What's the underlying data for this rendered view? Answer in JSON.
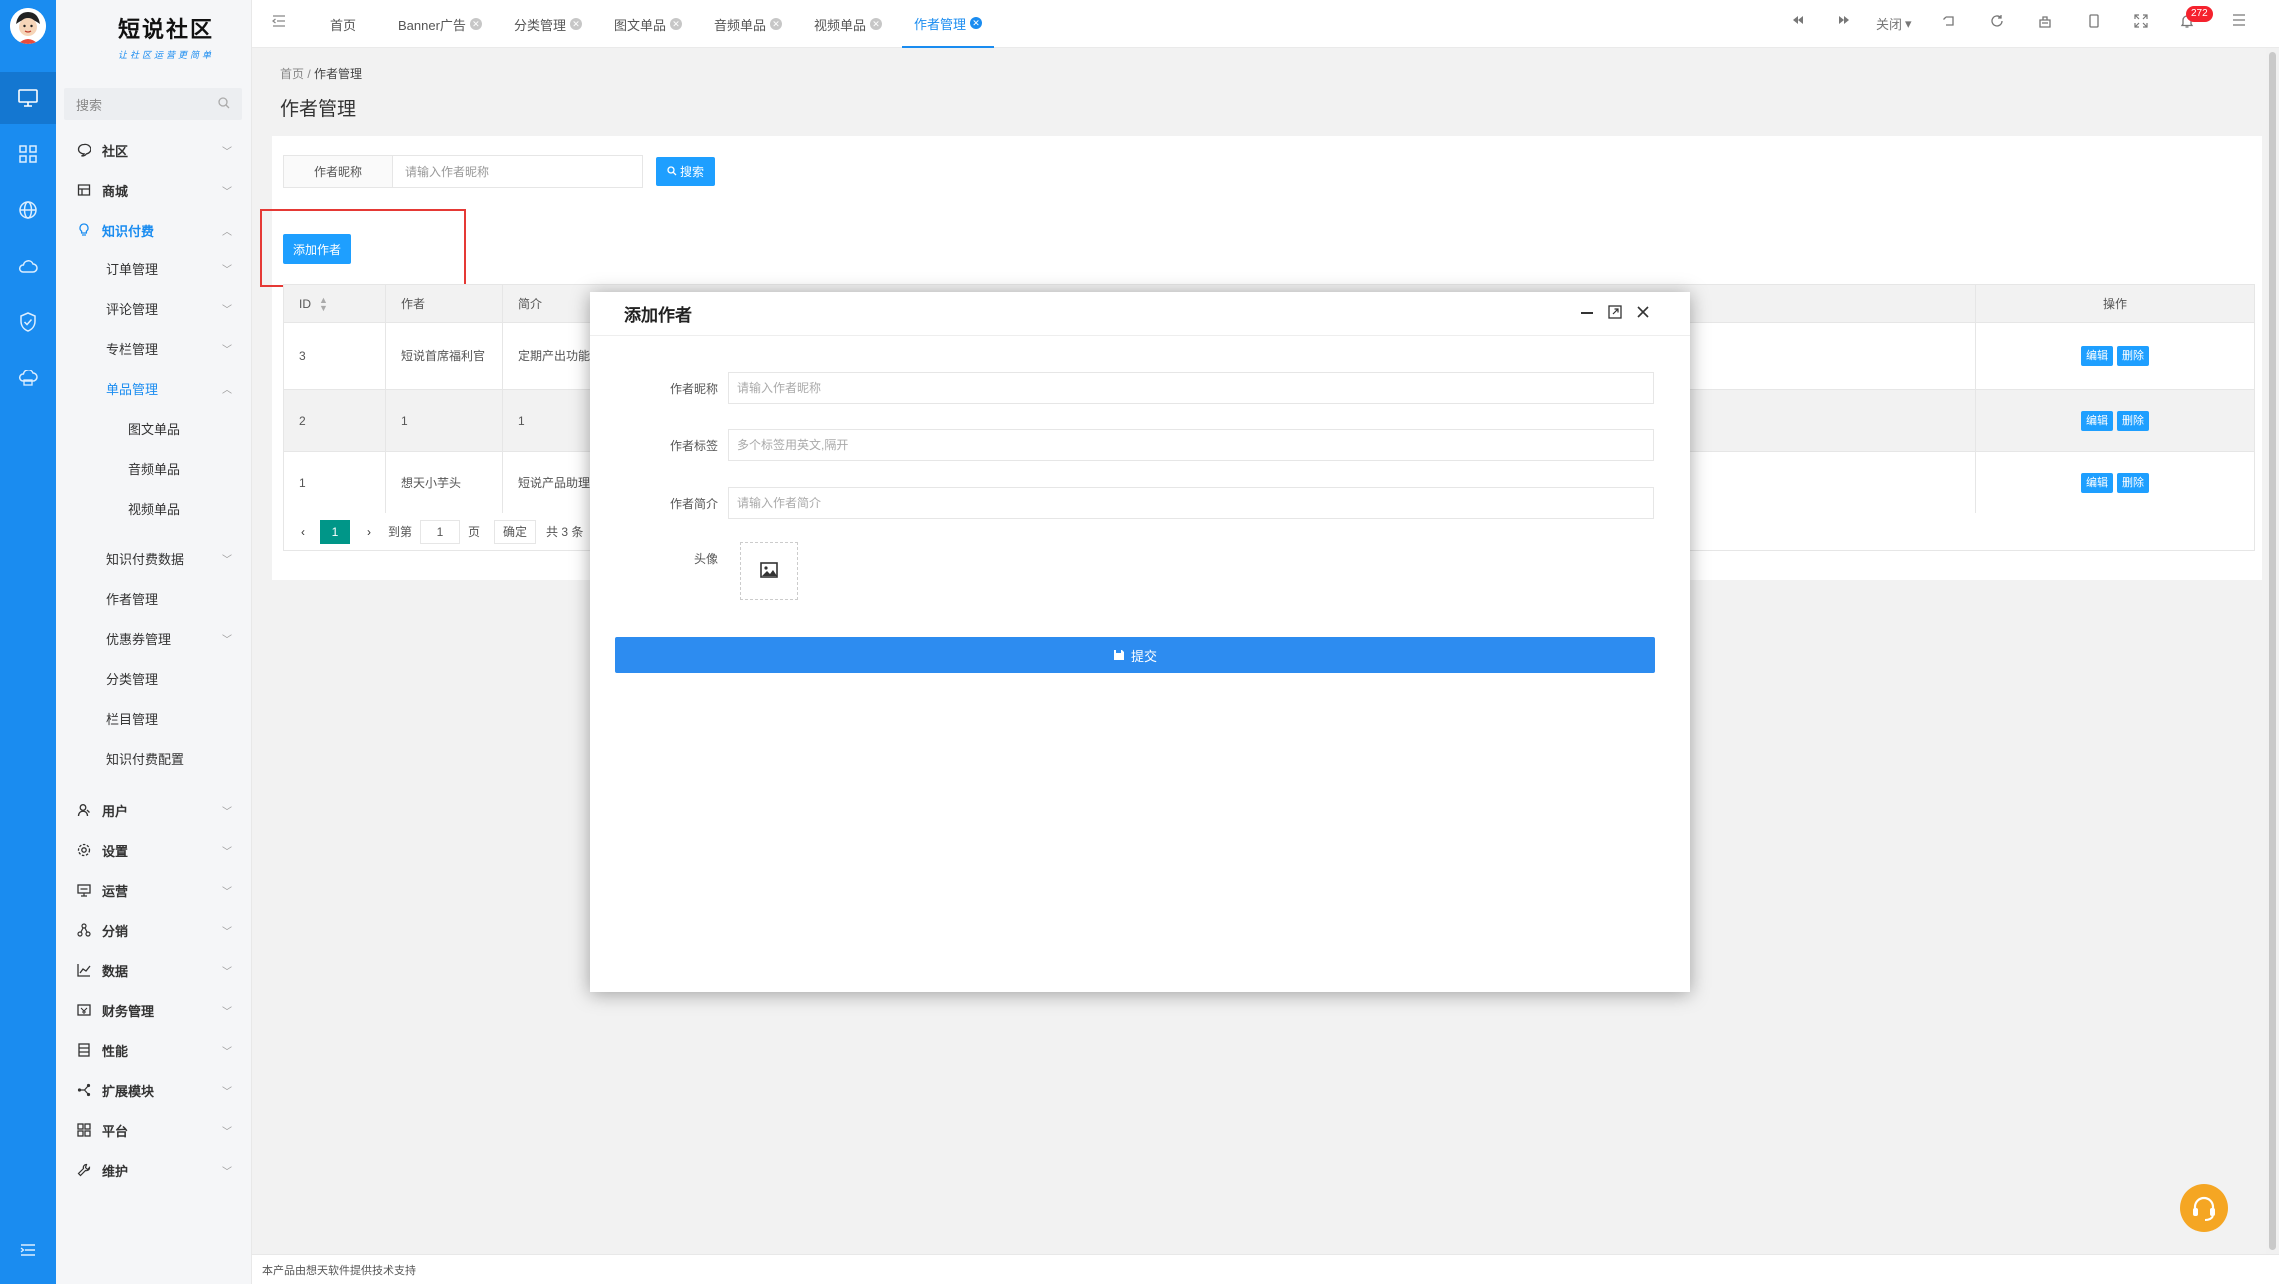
{
  "app": {
    "logo_title": "短说社区",
    "logo_subtitle": "让社区运营更简单"
  },
  "sidebar": {
    "search_placeholder": "搜索",
    "items": [
      {
        "label": "社区",
        "icon": "chat-icon",
        "expanded": false
      },
      {
        "label": "商城",
        "icon": "shop-icon",
        "expanded": false
      },
      {
        "label": "知识付费",
        "icon": "lightbulb-icon",
        "expanded": true
      },
      {
        "label": "订单管理"
      },
      {
        "label": "评论管理"
      },
      {
        "label": "专栏管理"
      },
      {
        "label": "单品管理",
        "expanded": true
      },
      {
        "label": "图文单品"
      },
      {
        "label": "音频单品"
      },
      {
        "label": "视频单品"
      },
      {
        "label": "知识付费数据"
      },
      {
        "label": "作者管理"
      },
      {
        "label": "优惠券管理"
      },
      {
        "label": "分类管理"
      },
      {
        "label": "栏目管理"
      },
      {
        "label": "知识付费配置"
      },
      {
        "label": "用户",
        "icon": "user-icon"
      },
      {
        "label": "设置",
        "icon": "gear-icon"
      },
      {
        "label": "运营",
        "icon": "monitor-icon"
      },
      {
        "label": "分销",
        "icon": "network-icon"
      },
      {
        "label": "数据",
        "icon": "line-chart-icon"
      },
      {
        "label": "财务管理",
        "icon": "wallet-icon"
      },
      {
        "label": "性能",
        "icon": "server-icon"
      },
      {
        "label": "扩展模块",
        "icon": "share-icon"
      },
      {
        "label": "平台",
        "icon": "grid-icon"
      },
      {
        "label": "维护",
        "icon": "wrench-icon"
      }
    ]
  },
  "tabs": [
    {
      "label": "首页",
      "closable": false,
      "active": false
    },
    {
      "label": "Banner广告",
      "closable": true,
      "active": false
    },
    {
      "label": "分类管理",
      "closable": true,
      "active": false
    },
    {
      "label": "图文单品",
      "closable": true,
      "active": false
    },
    {
      "label": "音频单品",
      "closable": true,
      "active": false
    },
    {
      "label": "视频单品",
      "closable": true,
      "active": false
    },
    {
      "label": "作者管理",
      "closable": true,
      "active": true
    }
  ],
  "toolbar": {
    "close_label": "关闭",
    "notification_count": "272"
  },
  "breadcrumb": {
    "home": "首页",
    "current": "作者管理"
  },
  "page": {
    "title": "作者管理"
  },
  "search": {
    "label": "作者昵称",
    "placeholder": "请输入作者昵称",
    "button": "搜索"
  },
  "add_button": "添加作者",
  "table": {
    "headers": {
      "id": "ID",
      "author": "作者",
      "intro": "简介",
      "ops": "操作"
    },
    "rows": [
      {
        "id": "3",
        "author": "短说首席福利官",
        "intro": "定期产出功能"
      },
      {
        "id": "2",
        "author": "1",
        "intro": "1"
      },
      {
        "id": "1",
        "author": "想天小芋头",
        "intro": "短说产品助理"
      }
    ],
    "edit_label": "编辑",
    "delete_label": "删除"
  },
  "pagination": {
    "current": "1",
    "goto_label": "到第",
    "page_input": "1",
    "page_suffix": "页",
    "confirm": "确定",
    "total": "共 3 条"
  },
  "modal": {
    "title": "添加作者",
    "fields": [
      {
        "label": "作者昵称",
        "placeholder": "请输入作者昵称"
      },
      {
        "label": "作者标签",
        "placeholder": "多个标签用英文,隔开"
      },
      {
        "label": "作者简介",
        "placeholder": "请输入作者简介"
      }
    ],
    "avatar_label": "头像",
    "submit": "提交"
  },
  "footer": {
    "text": "本产品由想天软件提供技术支持"
  },
  "colors": {
    "primary": "#1a8cf0",
    "button": "#1e9fff",
    "pager_active": "#009688",
    "highlight": "#e53935",
    "fab": "#f5a623"
  }
}
